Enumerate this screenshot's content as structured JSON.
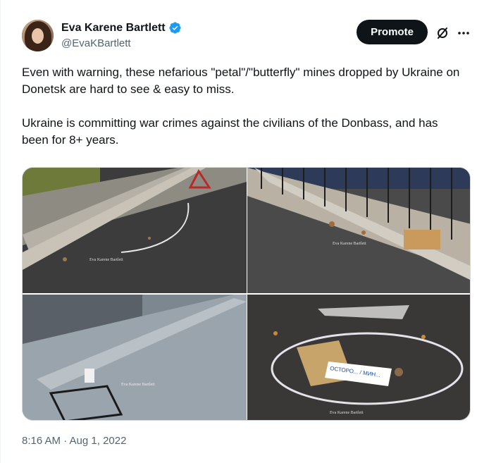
{
  "author": {
    "display_name": "Eva Karene Bartlett",
    "handle": "@EvaKBartlett",
    "verified": true
  },
  "header": {
    "promote_label": "Promote",
    "icons": [
      "grok-icon",
      "more-icon"
    ]
  },
  "tweet": {
    "paragraphs": [
      "Even with warning, these nefarious \"petal\"/\"butterfly\" mines dropped by Ukraine on Donetsk are hard to see & easy to miss.",
      "Ukraine is committing war crimes against the civilians of the Donbass, and has been for 8+ years."
    ],
    "timestamp": "8:16 AM · Aug 1, 2022"
  },
  "media": {
    "watermarks": [
      "Eva Karene Bartlett",
      "Eva Karene Bartlett",
      "Eva Karene Bartlett",
      "Eva Karene Bartlett"
    ],
    "sign_text": "ОСТОРО... / МИН..."
  },
  "colors": {
    "text": "#0f1419",
    "secondary": "#536471",
    "verified": "#1d9bf0",
    "button": "#0f1419"
  }
}
